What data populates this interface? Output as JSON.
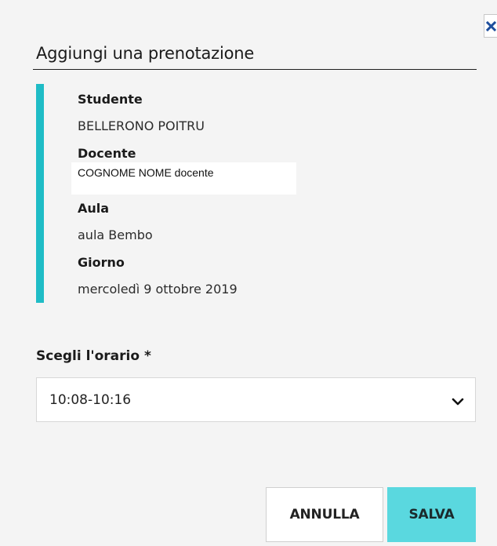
{
  "dialog": {
    "title": "Aggiungi una prenotazione",
    "close_icon": "close-icon"
  },
  "booking": {
    "student_label": "Studente",
    "student_value": "BELLERONO POITRU",
    "teacher_label": "Docente",
    "teacher_value": "COGNOME NOME docente",
    "room_label": "Aula",
    "room_value": "aula Bembo",
    "day_label": "Giorno",
    "day_value": "mercoledì 9 ottobre 2019"
  },
  "time_select": {
    "label": "Scegli l'orario *",
    "selected": "10:08-10:16",
    "chevron_icon": "chevron-down-icon"
  },
  "actions": {
    "cancel_label": "ANNULLA",
    "save_label": "SALVA"
  },
  "colors": {
    "accent": "#1fbcc6",
    "save_button": "#5ad8df",
    "close_icon": "#1e4e9c",
    "background": "#f4f4f4"
  }
}
